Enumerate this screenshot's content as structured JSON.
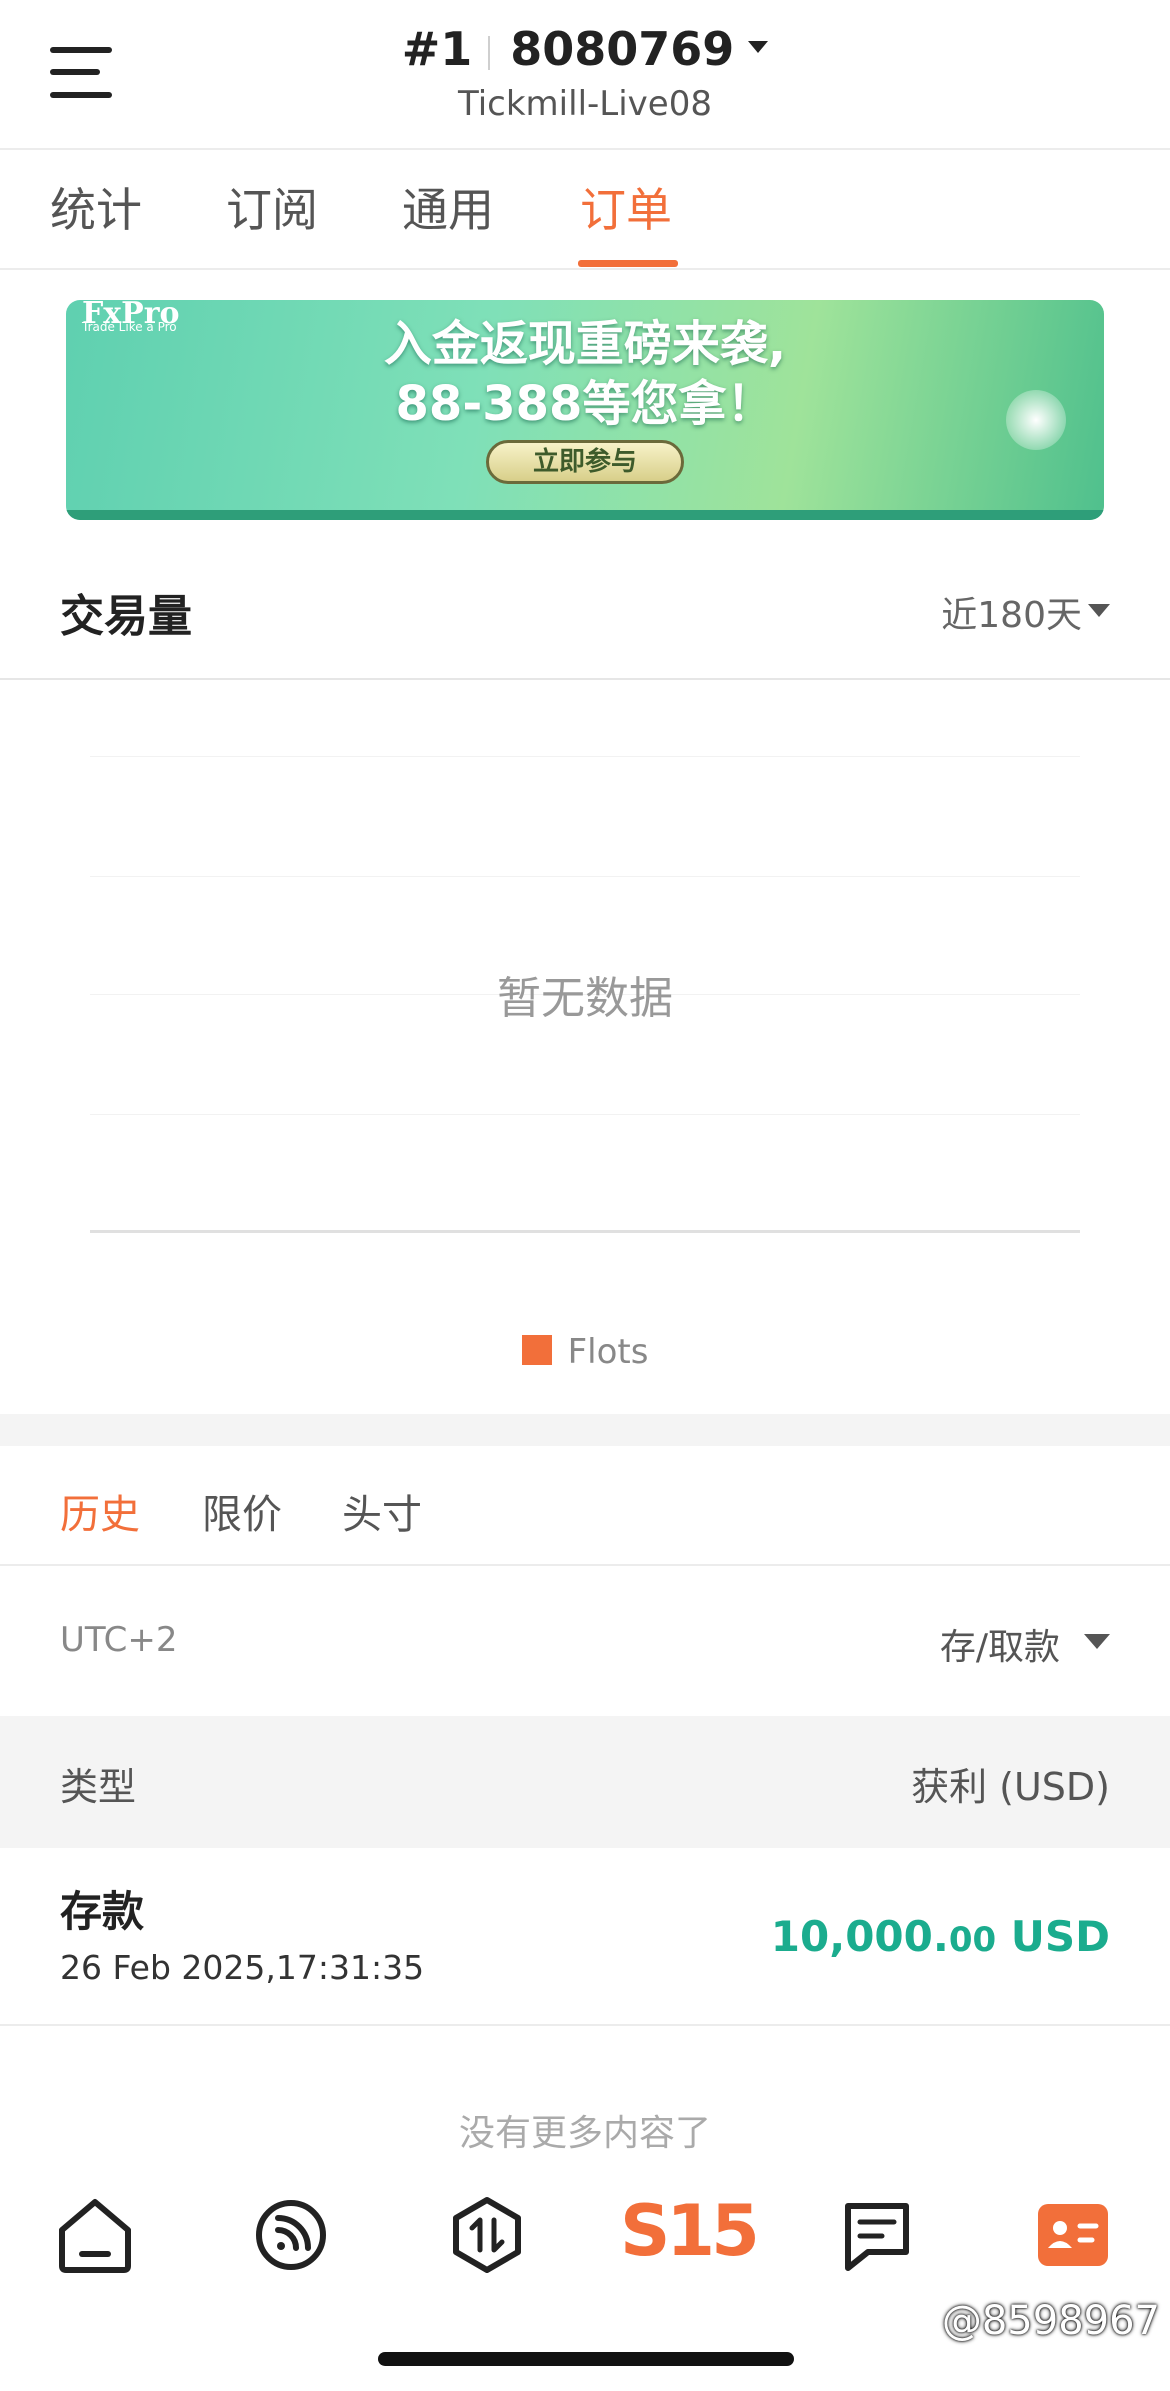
{
  "header": {
    "account_index": "#1",
    "account_number": "8080769",
    "server": "Tickmill-Live08"
  },
  "top_tabs": [
    {
      "label": "统计",
      "active": false
    },
    {
      "label": "订阅",
      "active": false
    },
    {
      "label": "通用",
      "active": false
    },
    {
      "label": "订单",
      "active": true
    }
  ],
  "banner": {
    "logo": "FxPro",
    "logo_sub": "Trade Like a Pro",
    "line1": "入金返现重磅来袭,",
    "line2": "88-388等您拿！",
    "button": "立即参与"
  },
  "volume": {
    "title": "交易量",
    "range": "近180天",
    "no_data": "暂无数据",
    "legend": "Flots",
    "legend_color": "#f26f3a"
  },
  "order_tabs": [
    {
      "label": "历史",
      "active": true
    },
    {
      "label": "限价",
      "active": false
    },
    {
      "label": "头寸",
      "active": false
    }
  ],
  "filter": {
    "timezone": "UTC+2",
    "type": "存/取款"
  },
  "table": {
    "col_type": "类型",
    "col_profit": "获利 (USD)"
  },
  "orders": [
    {
      "type": "存款",
      "time": "26 Feb 2025,17:31:35",
      "amount_int": "10,000.",
      "amount_dec": "00",
      "currency": " USD"
    }
  ],
  "no_more": "没有更多内容了",
  "bottom_nav": {
    "s15_label": "S15",
    "icons": [
      "home-icon",
      "feed-icon",
      "trade-icon",
      "s15-logo",
      "message-icon",
      "profile-card-icon"
    ]
  },
  "watermark": "@8598967",
  "colors": {
    "accent": "#f26f3a",
    "profit_green": "#1bac8e"
  }
}
